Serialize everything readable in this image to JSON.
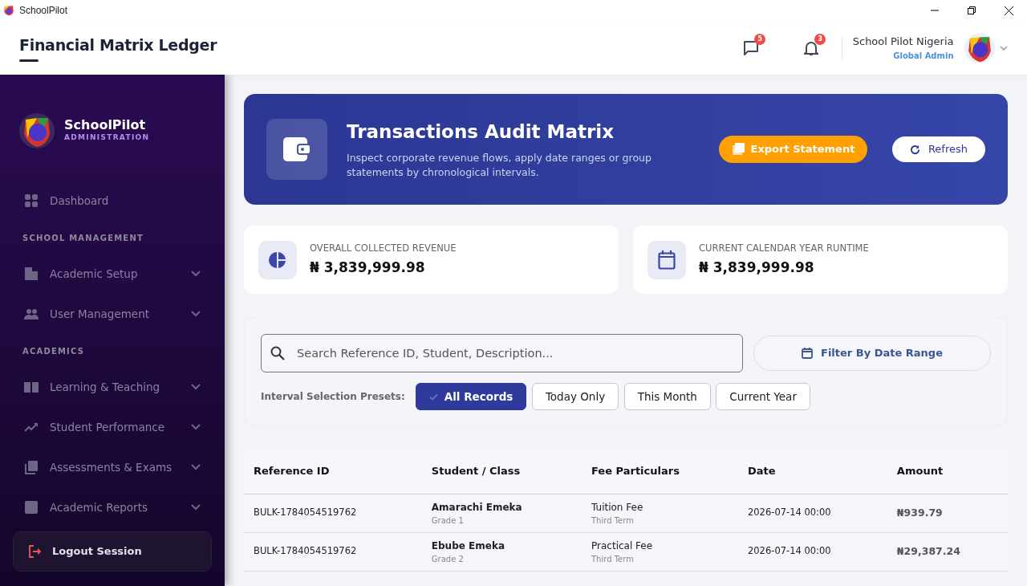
{
  "window": {
    "title": "SchoolPilot"
  },
  "header": {
    "title": "Financial Matrix Ledger",
    "messages_count": "5",
    "notifications_count": "3",
    "user_name": "School Pilot Nigeria",
    "user_role": "Global Admin"
  },
  "sidebar": {
    "brand": "SchoolPilot",
    "brand_sub": "ADMINISTRATION",
    "items": [
      {
        "kind": "link",
        "label": "Dashboard"
      },
      {
        "kind": "heading",
        "label": "SCHOOL MANAGEMENT"
      },
      {
        "kind": "group",
        "label": "Academic Setup",
        "expanded": false
      },
      {
        "kind": "group",
        "label": "User Management",
        "expanded": false
      },
      {
        "kind": "heading",
        "label": "ACADEMICS"
      },
      {
        "kind": "group",
        "label": "Learning & Teaching",
        "expanded": false
      },
      {
        "kind": "group",
        "label": "Student Performance",
        "expanded": false
      },
      {
        "kind": "group",
        "label": "Assessments & Exams",
        "expanded": false
      },
      {
        "kind": "group",
        "label": "Academic Reports",
        "expanded": false
      }
    ],
    "logout": "Logout Session"
  },
  "banner": {
    "title": "Transactions Audit Matrix",
    "subtitle": "Inspect corporate revenue flows, apply date ranges or group statements by chronological intervals.",
    "export_button": "Export Statement",
    "refresh_button": "Refresh"
  },
  "stats": [
    {
      "label": "OVERALL COLLECTED REVENUE",
      "value": "₦ 3,839,999.98"
    },
    {
      "label": "CURRENT CALENDAR YEAR RUNTIME",
      "value": "₦ 3,839,999.98"
    }
  ],
  "filters": {
    "search_placeholder": "Search Reference ID, Student, Description...",
    "date_button": "Filter By Date Range",
    "presets_label": "Interval Selection Presets:",
    "presets": [
      {
        "label": "All Records",
        "selected": true
      },
      {
        "label": "Today Only",
        "selected": false
      },
      {
        "label": "This Month",
        "selected": false
      },
      {
        "label": "Current Year",
        "selected": false
      }
    ]
  },
  "table": {
    "columns": [
      "Reference ID",
      "Student / Class",
      "Fee Particulars",
      "Date",
      "Amount"
    ],
    "rows": [
      {
        "reference": "BULK-1784054519762",
        "student": "Amarachi Emeka",
        "class": "Grade 1",
        "fee": "Tuition Fee",
        "term": "Third Term",
        "date": "2026-07-14 00:00",
        "amount": "₦939.79"
      },
      {
        "reference": "BULK-1784054519762",
        "student": "Ebube Emeka",
        "class": "Grade 2",
        "fee": "Practical Fee",
        "term": "Third Term",
        "date": "2026-07-14 00:00",
        "amount": "₦29,387.24"
      }
    ]
  }
}
